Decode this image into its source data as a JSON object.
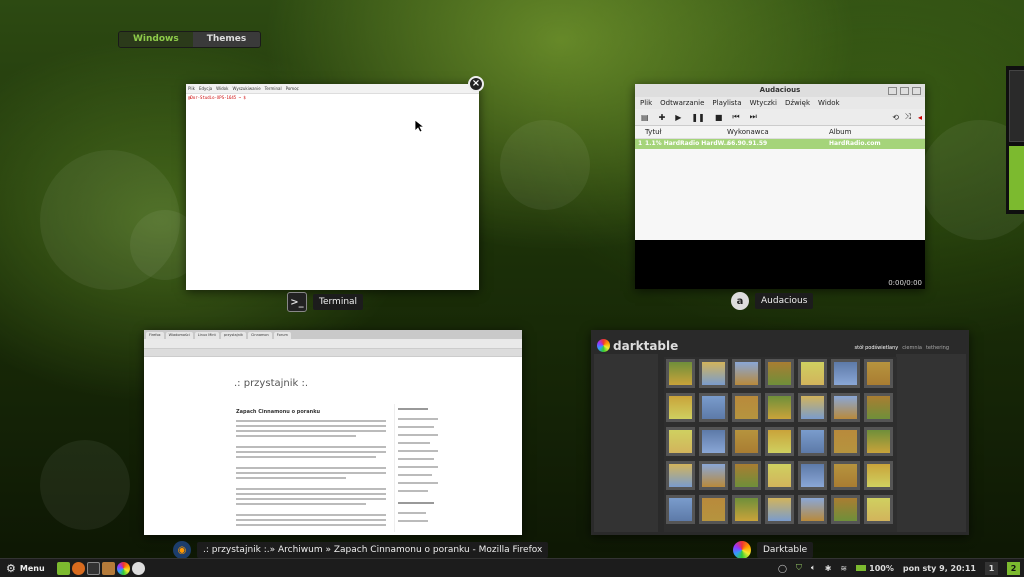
{
  "switcher": {
    "windows": "Windows",
    "themes": "Themes"
  },
  "windows": {
    "terminal": {
      "caption": "Terminal",
      "menu": [
        "Plik",
        "Edycja",
        "Widok",
        "Wyszukiwanie",
        "Terminal",
        "Pomoc"
      ],
      "prompt": "@Dor-Studio-XPS-1645 ~ $"
    },
    "audacious": {
      "caption": "Audacious",
      "title": "Audacious",
      "menu": [
        "Plik",
        "Odtwarzanie",
        "Playlista",
        "Wtyczki",
        "Dźwięk",
        "Widok"
      ],
      "columns": [
        "Tytuł",
        "Wykonawca",
        "Album"
      ],
      "row": {
        "num": "1",
        "title": "1.1% HardRadio HardW...",
        "artist": "66.90.91.59",
        "album": "HardRadio.com"
      },
      "time": "0:00/0:00"
    },
    "firefox": {
      "caption": ".: przystajnik :.» Archiwum » Zapach Cinnamonu o poranku - Mozilla Firefox",
      "site_title": ".: przystajnik :.",
      "post_title": "Zapach Cinnamonu o poranku"
    },
    "darktable": {
      "caption": "Darktable",
      "logo": "darktable",
      "views": [
        "stół podświetlany",
        "ciemnia",
        "tethering"
      ]
    }
  },
  "panel": {
    "menu_label": "Menu",
    "battery": "100%",
    "clock": "pon sty  9, 20:11",
    "workspaces": [
      "1",
      "2"
    ],
    "colors": {
      "accent": "#8ecb4b",
      "panel": "#1c1c1c"
    }
  }
}
